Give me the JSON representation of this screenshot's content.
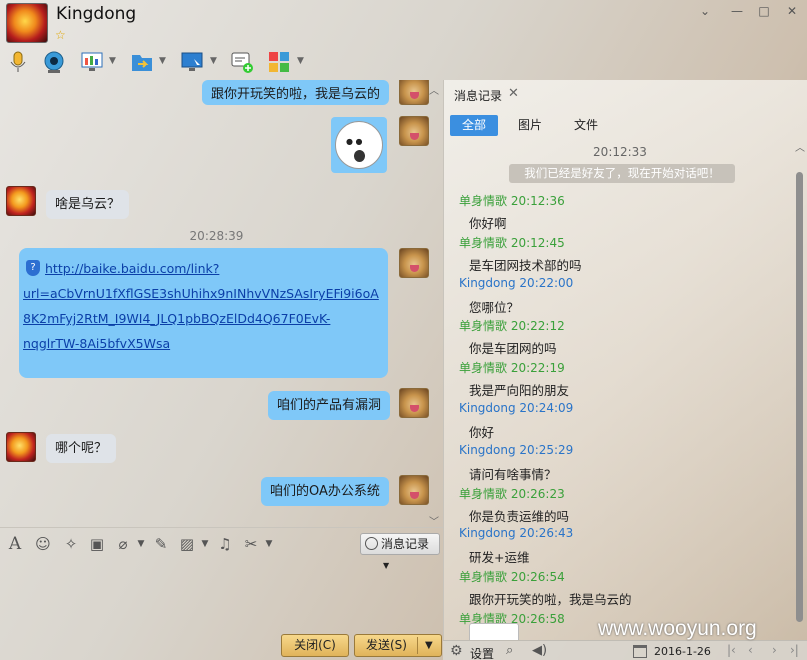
{
  "window": {
    "contact_name": "Kingdong",
    "vip_star": "☆",
    "buttons": {
      "min": "⌄",
      "max": "□",
      "close": "✕",
      "menu": "—"
    }
  },
  "toolbar": {
    "icons": [
      "microphone-icon",
      "camera-icon",
      "screen-share-icon",
      "file-transfer-icon",
      "remote-desktop-icon",
      "chat-add-icon",
      "apps-grid-icon"
    ]
  },
  "chat": {
    "messages": [
      {
        "from": "me",
        "text": "跟你开玩笑的啦，我是乌云的"
      },
      {
        "from": "me",
        "type": "sticker"
      },
      {
        "from": "other",
        "text": "啥是乌云？"
      },
      {
        "type": "time",
        "text": "20:28:39"
      },
      {
        "from": "me",
        "type": "link",
        "lines": [
          "http://baike.baidu.com/link?",
          "url=aCbVrnU1fXflGSE3shUhihx9nINhvVNzSAsIryEFi9i6oA",
          "8K2mFyj2RtM_I9WI4_JLQ1pbBQzElDd4Q67F0EvK-",
          "nqglrTW-8Ai5bfvX5Wsa"
        ]
      },
      {
        "from": "me",
        "text": "咱们的产品有漏洞"
      },
      {
        "from": "other",
        "text": "哪个呢？"
      },
      {
        "from": "me",
        "text": "咱们的OA办公系统"
      }
    ]
  },
  "input_toolbar": {
    "history_label": "消息记录",
    "icons": [
      "font-icon",
      "emoji-icon",
      "magic-icon",
      "video-icon",
      "voice-icon",
      "edit-icon",
      "image-icon",
      "music-icon",
      "scissors-icon"
    ]
  },
  "footer": {
    "close_label": "关闭(C)",
    "send_label": "发送(S)"
  },
  "history": {
    "title": "消息记录",
    "tabs": [
      "全部",
      "图片",
      "文件"
    ],
    "start_time": "20:12:33",
    "system_note": "我们已经是好友了，现在开始对话吧！",
    "entries": [
      {
        "who": "单身情歌 20:12:36",
        "color": "green",
        "text": "你好啊"
      },
      {
        "who": "单身情歌 20:12:45",
        "color": "green",
        "text": "是车团网技术部的吗"
      },
      {
        "who": "Kingdong 20:22:00",
        "color": "blue",
        "text": "您哪位？"
      },
      {
        "who": "单身情歌 20:22:12",
        "color": "green",
        "text": "你是车团网的吗"
      },
      {
        "who": "单身情歌 20:22:19",
        "color": "green",
        "text": "我是严向阳的朋友"
      },
      {
        "who": "Kingdong 20:24:09",
        "color": "blue",
        "text": "你好"
      },
      {
        "who": "Kingdong 20:25:29",
        "color": "blue",
        "text": "请问有啥事情？"
      },
      {
        "who": "单身情歌 20:26:23",
        "color": "green",
        "text": "你是负责运维的吗"
      },
      {
        "who": "Kingdong 20:26:43",
        "color": "blue",
        "text": "研发+运维"
      },
      {
        "who": "单身情歌 20:26:54",
        "color": "green",
        "text": "跟你开玩笑的啦，我是乌云的"
      },
      {
        "who": "单身情歌 20:26:58",
        "color": "green",
        "text": ""
      }
    ],
    "footer": {
      "settings": "设置",
      "date": "2016-1-26"
    }
  },
  "watermark": "www.wooyun.org"
}
